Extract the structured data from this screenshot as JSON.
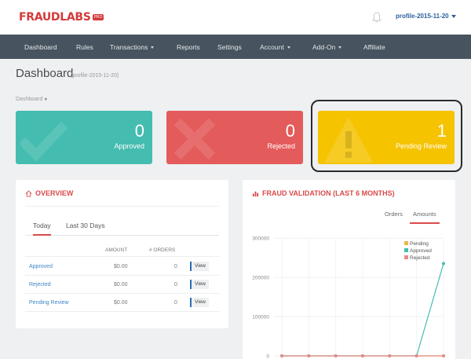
{
  "brand": {
    "logo_text": "FRAUDLABS",
    "logo_badge": "PRO"
  },
  "header": {
    "profile_label": "profile-2015-11-20"
  },
  "nav": {
    "items": [
      {
        "label": "Dashboard",
        "dropdown": false
      },
      {
        "label": "Rules",
        "dropdown": false
      },
      {
        "label": "Transactions",
        "dropdown": true
      },
      {
        "label": "Reports",
        "dropdown": false
      },
      {
        "label": "Settings",
        "dropdown": false
      },
      {
        "label": "Account",
        "dropdown": true
      },
      {
        "label": "Add-On",
        "dropdown": true
      },
      {
        "label": "Affiliate",
        "dropdown": false
      }
    ]
  },
  "page": {
    "title": "Dashboard",
    "subtitle": "(profile-2015-11-20)",
    "breadcrumb": "Dashboard"
  },
  "cards": {
    "approved": {
      "value": "0",
      "label": "Approved",
      "color": "#45bcb0"
    },
    "rejected": {
      "value": "0",
      "label": "Rejected",
      "color": "#e45b5b"
    },
    "pending": {
      "value": "1",
      "label": "Pending Review",
      "color": "#f5c300"
    }
  },
  "overview": {
    "title": "OVERVIEW",
    "tabs": [
      "Today",
      "Last 30 Days"
    ],
    "columns": {
      "amount": "AMOUNT",
      "orders": "# ORDERS"
    },
    "rows": [
      {
        "name": "Approved",
        "amount": "$0.00",
        "orders": "0",
        "action": "View"
      },
      {
        "name": "Rejected",
        "amount": "$0.00",
        "orders": "0",
        "action": "View"
      },
      {
        "name": "Pending Review",
        "amount": "$0.00",
        "orders": "0",
        "action": "View"
      }
    ]
  },
  "fraud": {
    "title": "FRAUD VALIDATION (LAST 6 MONTHS)",
    "tabs": [
      "Orders",
      "Amounts"
    ]
  },
  "chart_data": {
    "type": "line",
    "x": [
      1,
      2,
      3,
      4,
      5,
      6,
      7
    ],
    "series": [
      {
        "name": "Pending",
        "values": [
          0,
          0,
          0,
          0,
          0,
          0,
          0
        ],
        "color": "#e8b84a"
      },
      {
        "name": "Approved",
        "values": [
          0,
          0,
          0,
          0,
          0,
          0,
          235000
        ],
        "color": "#45bcb0"
      },
      {
        "name": "Rejected",
        "values": [
          0,
          0,
          0,
          0,
          0,
          0,
          0
        ],
        "color": "#e88a8a"
      }
    ],
    "y_ticks": [
      "300000",
      "200000",
      "100000",
      "0"
    ],
    "ylim": [
      0,
      300000
    ],
    "legend_position": "top-right",
    "grid": true
  }
}
